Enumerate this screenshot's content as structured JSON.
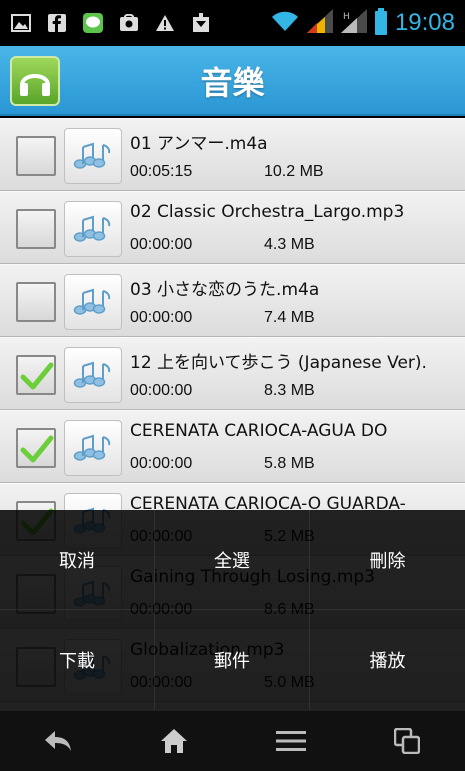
{
  "status_bar": {
    "icons": [
      "gallery-icon",
      "facebook-icon",
      "line-icon",
      "store-icon",
      "alert-icon",
      "download-icon"
    ],
    "time": "19:08",
    "accent": "#33b5e5"
  },
  "header": {
    "title": "音樂",
    "app_icon": "headphones-icon"
  },
  "songs": [
    {
      "title": "01 アンマー.m4a",
      "duration": "00:05:15",
      "size": "10.2 MB",
      "checked": false
    },
    {
      "title": "02 Classic Orchestra_Largo.mp3",
      "duration": "00:00:00",
      "size": "4.3 MB",
      "checked": false
    },
    {
      "title": "03 小さな恋のうた.m4a",
      "duration": "00:00:00",
      "size": "7.4 MB",
      "checked": false
    },
    {
      "title": "12 上を向いて歩こう (Japanese Ver).",
      "duration": "00:00:00",
      "size": "8.3 MB",
      "checked": true
    },
    {
      "title": "CERENATA CARIOCA-AGUA DO",
      "duration": "00:00:00",
      "size": "5.8 MB",
      "checked": true
    },
    {
      "title": "CERENATA CARIOCA-O GUARDA-",
      "duration": "00:00:00",
      "size": "5.2 MB",
      "checked": true
    },
    {
      "title": "Gaining Through Losing.mp3",
      "duration": "00:00:00",
      "size": "8.6 MB",
      "checked": false
    },
    {
      "title": "Globalization.mp3",
      "duration": "00:00:00",
      "size": "5.0 MB",
      "checked": false
    }
  ],
  "menu": {
    "cancel": "取消",
    "select_all": "全選",
    "delete": "刪除",
    "download": "下載",
    "email": "郵件",
    "play": "播放"
  },
  "nav": [
    "back-icon",
    "home-icon",
    "menu-icon",
    "recent-apps-icon"
  ]
}
